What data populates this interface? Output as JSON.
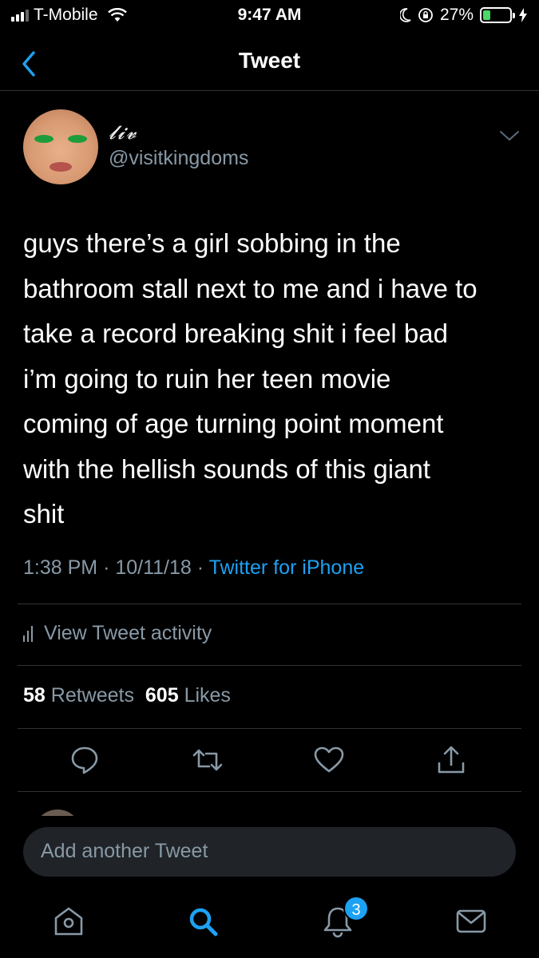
{
  "status_bar": {
    "carrier": "T-Mobile",
    "time": "9:47 AM",
    "battery_percent": "27%",
    "battery_level": 0.27,
    "colors": {
      "battery": "#4cd964"
    }
  },
  "header": {
    "title": "Tweet",
    "back_icon": "chevron-left-icon"
  },
  "tweet": {
    "display_name": "𝓵𝓲𝓿",
    "handle": "@visitkingdoms",
    "text": "guys there’s a girl sobbing in the\nbathroom stall next to me and i have to\ntake a record breaking shit i feel bad\ni’m going to ruin her teen movie\ncoming of age turning point moment\nwith the hellish sounds of this giant\nshit",
    "time": "1:38 PM",
    "date": "10/11/18",
    "separator": "·",
    "source": "Twitter for iPhone",
    "activity_label": "View Tweet activity",
    "retweets_count": "58",
    "retweets_label": "Retweets",
    "likes_count": "605",
    "likes_label": "Likes"
  },
  "actions": [
    {
      "name": "reply",
      "icon": "reply-icon"
    },
    {
      "name": "retweet",
      "icon": "retweet-icon"
    },
    {
      "name": "like",
      "icon": "heart-icon"
    },
    {
      "name": "share",
      "icon": "share-icon"
    }
  ],
  "compose": {
    "placeholder": "Add another Tweet"
  },
  "tab_bar": {
    "notifications_badge": "3",
    "tabs": [
      "home-icon",
      "search-icon",
      "notifications-icon",
      "messages-icon"
    ]
  },
  "colors": {
    "background": "#000000",
    "primary_text": "#ffffff",
    "secondary_text": "#8899a6",
    "accent": "#1da1f2",
    "divider": "#2f3336"
  }
}
